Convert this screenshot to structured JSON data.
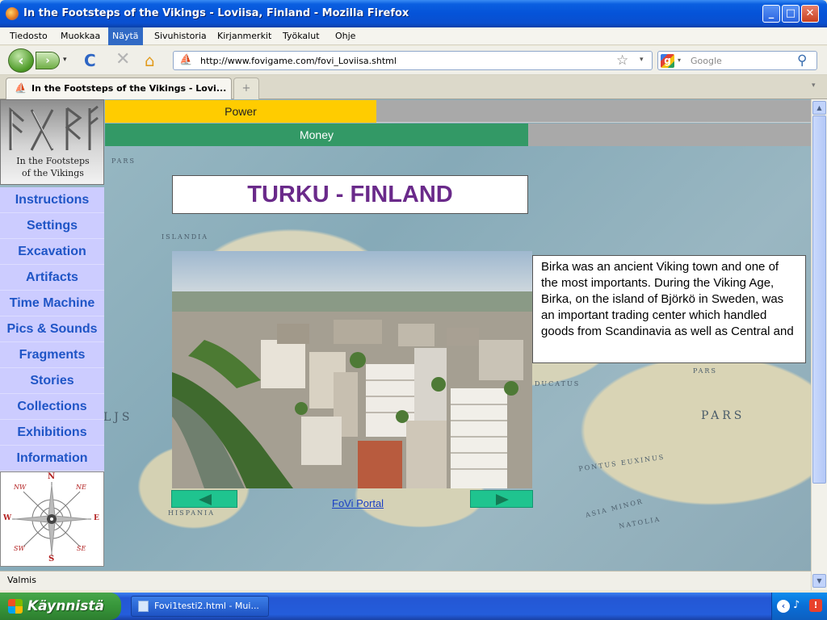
{
  "window": {
    "title": "In the Footsteps of the Vikings - Loviisa, Finland - Mozilla Firefox",
    "minimize_icon": "_",
    "maximize_icon": "□",
    "close_icon": "✕"
  },
  "menu": {
    "items": [
      "Tiedosto",
      "Muokkaa",
      "Näytä",
      "Sivuhistoria",
      "Kirjanmerkit",
      "Työkalut",
      "Ohje"
    ],
    "active_index": 2
  },
  "nav": {
    "back_icon": "‹",
    "forward_icon": "›",
    "dropdown_icon": "▾",
    "reload_icon": "C",
    "stop_icon": "✕",
    "home_icon": "⌂",
    "url": "http://www.fovigame.com/fovi_Loviisa.shtml",
    "bookmark_icon": "☆",
    "url_dropdown_icon": "▾",
    "search_placeholder": "Google",
    "search_engine_letter": "g",
    "search_icon": "⚲"
  },
  "tabs": {
    "active_label": "In the Footsteps of the Vikings - Lovi...",
    "new_tab_icon": "+",
    "tab_list_icon": "▾"
  },
  "page": {
    "power_label": "Power",
    "money_label": "Money",
    "logo_text_line1": "In the Footsteps",
    "logo_text_line2": "of the Vikings",
    "sidebar_items": [
      "Instructions",
      "Settings",
      "Excavation",
      "Artifacts",
      "Time Machine",
      "Pics & Sounds",
      "Fragments",
      "Stories",
      "Collections",
      "Exhibitions",
      "Information"
    ],
    "compass": {
      "n": "N",
      "ne": "NE",
      "e": "E",
      "se": "SE",
      "s": "S",
      "sw": "SW",
      "w": "W",
      "nw": "NW"
    },
    "location_title": "TURKU - FINLAND",
    "description": "Birka was an ancient Viking town and one of the most importants. During the Viking Age, Birka, on the island of Björkö in Sweden, was an important trading center which handled goods from Scandinavia as well as Central and",
    "portal_link": "FoVi Portal",
    "map_labels": {
      "pars_top": "PARS",
      "islandia": "ISLANDIA",
      "pars_mid": "PARS",
      "pars_right": "PARS",
      "ducatus": "DUCATUS",
      "pontus": "PONTUS EUXINUS",
      "natolia": "NATOLIA",
      "asia_minor": "ASIA MINOR",
      "hispania": "HISPANIA",
      "ljs": "LJS"
    },
    "colors": {
      "power": "#ffcc00",
      "money": "#339966",
      "sidebar": "#ccccff",
      "title_text": "#6a2a8a",
      "arrow_buttons": "#1fc48f"
    }
  },
  "status": {
    "text": "Valmis"
  },
  "taskbar": {
    "start_label": "Käynnistä",
    "task_label": "Fovi1testi2.html - Mui...",
    "tray_expand_icon": "‹",
    "tray_speaker_icon": "♪",
    "tray_alert_icon": "!"
  }
}
